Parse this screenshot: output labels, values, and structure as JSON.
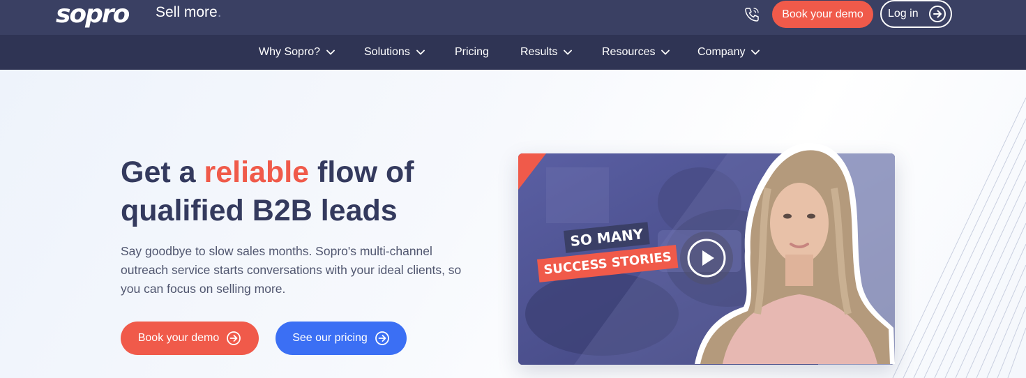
{
  "header": {
    "logo_text": "sopro",
    "tagline": "Sell more",
    "tagline_suffix": ".",
    "phone_icon": "phone-icon",
    "book_demo_label": "Book your demo",
    "login_label": "Log in"
  },
  "nav": {
    "items": [
      {
        "label": "Why Sopro?",
        "has_dropdown": true
      },
      {
        "label": "Solutions",
        "has_dropdown": true
      },
      {
        "label": "Pricing",
        "has_dropdown": false
      },
      {
        "label": "Results",
        "has_dropdown": true
      },
      {
        "label": "Resources",
        "has_dropdown": true
      },
      {
        "label": "Company",
        "has_dropdown": true
      }
    ]
  },
  "hero": {
    "headline_part1": "Get a ",
    "headline_accent": "reliable",
    "headline_part2": " flow of",
    "headline_line2": "qualified B2B leads",
    "subtext": "Say goodbye to slow sales months. Sopro's multi-channel outreach service starts conversations with your ideal clients, so you can focus on selling more.",
    "primary_button": "Book your demo",
    "secondary_button": "See our pricing"
  },
  "video": {
    "caption_line1": "SO MANY",
    "caption_line2": "SUCCESS STORIES",
    "play_icon": "play-icon"
  },
  "colors": {
    "topbar": "#3a4063",
    "navbar": "#2f3454",
    "accent": "#f05a4a",
    "blue": "#3b6ff4",
    "headline": "#343a5e"
  }
}
